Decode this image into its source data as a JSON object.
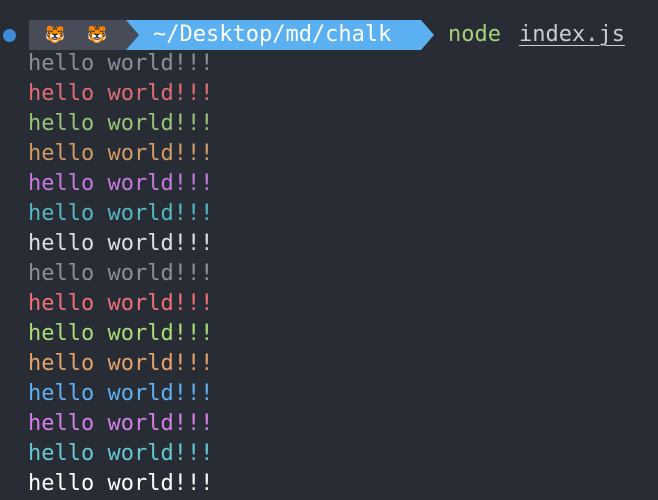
{
  "prompt": {
    "status_icon": "circle",
    "status_color": "#3f8ad8",
    "segment_icons": [
      "tiger-face-icon",
      "tiger-face-icon"
    ],
    "segment_icon_glyph": "🐯",
    "path": "~/Desktop/md/chalk",
    "command": "node",
    "argument": "index.js"
  },
  "colors": {
    "background": "#282c34",
    "icons_segment": "#474c58",
    "path_segment": "#5ab0f0"
  },
  "output": [
    {
      "text": "hello world!!!",
      "color": "#8a8f98"
    },
    {
      "text": "hello world!!!",
      "color": "#e06c75"
    },
    {
      "text": "hello world!!!",
      "color": "#98c379"
    },
    {
      "text": "hello world!!!",
      "color": "#d19a66"
    },
    {
      "text": "hello world!!!",
      "color": "#c678dd"
    },
    {
      "text": "hello world!!!",
      "color": "#56b6c2"
    },
    {
      "text": "hello world!!!",
      "color": "#dcdfe4"
    },
    {
      "text": "hello world!!!",
      "color": "#8a8f98"
    },
    {
      "text": "hello world!!!",
      "color": "#ef6f78"
    },
    {
      "text": "hello world!!!",
      "color": "#a9dc76"
    },
    {
      "text": "hello world!!!",
      "color": "#e5a266"
    },
    {
      "text": "hello world!!!",
      "color": "#61afef"
    },
    {
      "text": "hello world!!!",
      "color": "#d47ee8"
    },
    {
      "text": "hello world!!!",
      "color": "#66c6d2"
    },
    {
      "text": "hello world!!!",
      "color": "#ffffff"
    }
  ]
}
